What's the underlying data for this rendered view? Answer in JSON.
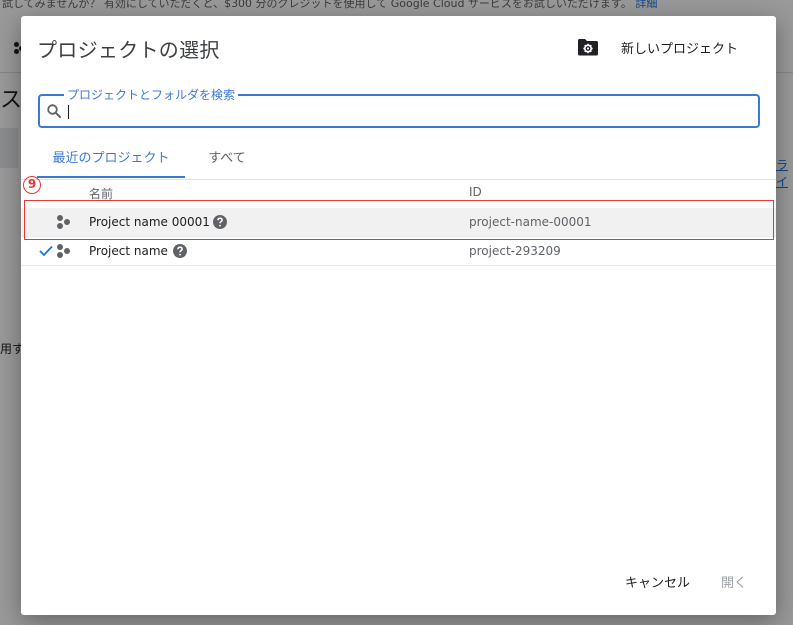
{
  "background": {
    "banner_text": "試してみませんか？ 有効にしていただくと、$300 分のクレジットを使用して Google Cloud サービスをお試しいただけます。",
    "banner_link": "詳細",
    "heading_fragment": "ス",
    "body_fragment": "用する",
    "right_link_fragment": "ライ"
  },
  "dialog": {
    "title": "プロジェクトの選択",
    "new_project_label": "新しいプロジェクト",
    "search": {
      "label": "プロジェクトとフォルダを検索",
      "value": "",
      "placeholder": ""
    },
    "tabs": [
      {
        "label": "最近のプロジェクト",
        "active": true
      },
      {
        "label": "すべて",
        "active": false
      }
    ],
    "marker_number": "9",
    "columns": {
      "name": "名前",
      "id": "ID"
    },
    "projects": [
      {
        "name": "Project name 00001",
        "id": "project-name-00001",
        "selected": false,
        "hovered": true
      },
      {
        "name": "Project name",
        "id": "project-293209",
        "selected": true,
        "hovered": false
      }
    ],
    "buttons": {
      "cancel": "キャンセル",
      "open": "開く"
    }
  },
  "colors": {
    "accent": "#3c78d8",
    "annotation": "#e53935",
    "check": "#1a73e8"
  },
  "icons": {
    "new_project": "folder-gear-icon",
    "search": "search-icon",
    "project": "project-icon",
    "help": "help-icon",
    "selected": "check-icon"
  }
}
